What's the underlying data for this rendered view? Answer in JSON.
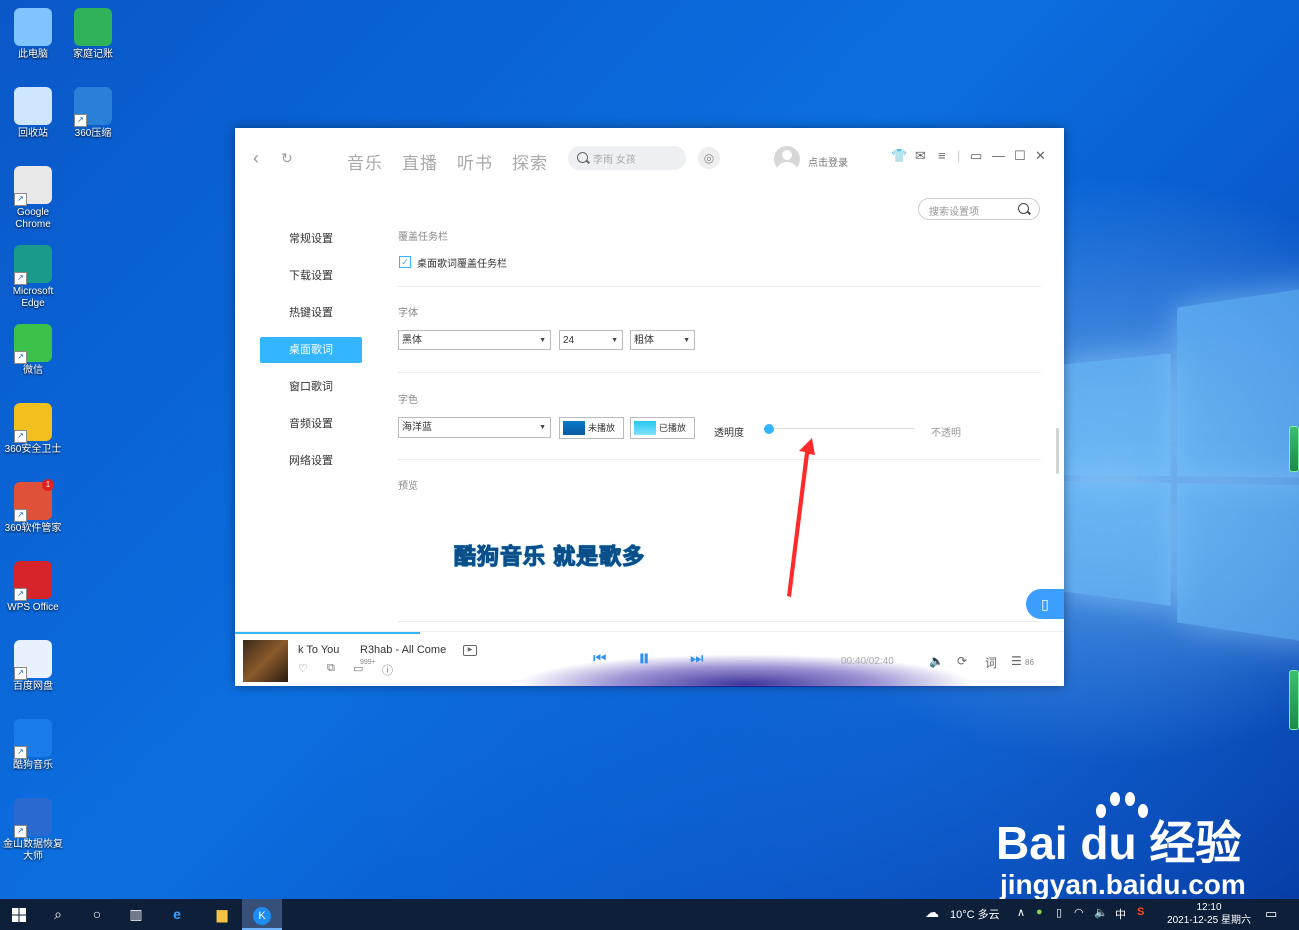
{
  "desktop": {
    "icons": [
      {
        "label": "此电脑",
        "icon": "computer-icon"
      },
      {
        "label": "家庭记账",
        "icon": "spreadsheet-icon"
      },
      {
        "label": "回收站",
        "icon": "recycle-bin-icon"
      },
      {
        "label": "360压缩",
        "icon": "archive-icon"
      },
      {
        "label": "Google Chrome",
        "icon": "chrome-icon"
      },
      {
        "label": "Microsoft Edge",
        "icon": "edge-icon"
      },
      {
        "label": "微信",
        "icon": "wechat-icon"
      },
      {
        "label": "360安全卫士",
        "icon": "360-security-icon"
      },
      {
        "label": "360软件管家",
        "icon": "360-software-icon"
      },
      {
        "label": "WPS Office",
        "icon": "wps-icon"
      },
      {
        "label": "百度网盘",
        "icon": "baidu-netdisk-icon"
      },
      {
        "label": "酷狗音乐",
        "icon": "kugou-icon"
      },
      {
        "label": "金山数据恢复大师",
        "icon": "data-recovery-icon"
      }
    ],
    "badge_360_software": "1"
  },
  "app": {
    "tabs": [
      "音乐",
      "直播",
      "听书",
      "探索"
    ],
    "search_placeholder": "李雨 女孩",
    "login_text": "点击登录",
    "settings_search_placeholder": "搜索设置项",
    "sidebar": [
      {
        "label": "常规设置",
        "active": false
      },
      {
        "label": "下载设置",
        "active": false
      },
      {
        "label": "热键设置",
        "active": false
      },
      {
        "label": "桌面歌词",
        "active": true
      },
      {
        "label": "窗口歌词",
        "active": false
      },
      {
        "label": "音频设置",
        "active": false
      },
      {
        "label": "网络设置",
        "active": false
      }
    ],
    "sections": {
      "cover_taskbar_title": "覆盖任务栏",
      "cover_taskbar_checkbox": "桌面歌词覆盖任务栏",
      "cover_taskbar_checked": true,
      "font_title": "字体",
      "font_family": "黑体",
      "font_size": "24",
      "font_weight": "粗体",
      "color_title": "字色",
      "color_scheme": "海洋蓝",
      "unplayed_label": "未播放",
      "played_label": "已播放",
      "unplayed_color": "#0a79c9",
      "played_color": "#27c6f2",
      "opacity_label": "透明度",
      "opacity_value": 0,
      "opacity_max_label": "不透明",
      "preview_title": "预览",
      "preview_lyric": "酷狗音乐  就是歌多"
    },
    "player": {
      "song": "k To You",
      "artist": "R3hab - All Come",
      "comment_count": "999+",
      "time": "00:40/02:40",
      "lyrics_btn": "词",
      "playlist_count": "86",
      "progress": 0.25
    }
  },
  "taskbar": {
    "weather": "10°C 多云",
    "ime": "中",
    "time": "12:10",
    "date": "2021-12-25 星期六"
  },
  "watermark": {
    "brand": "Bai du 经验",
    "url": "jingyan.baidu.com"
  }
}
